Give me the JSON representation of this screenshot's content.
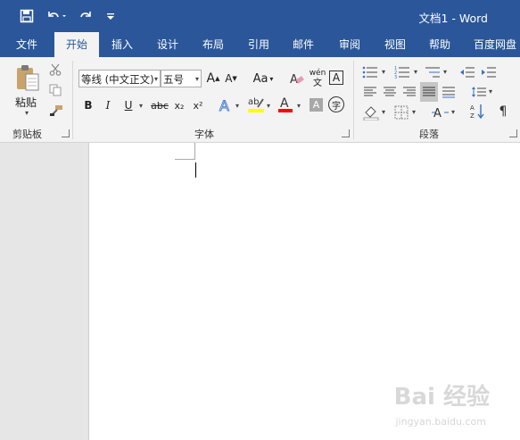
{
  "title_bar": {
    "document_title": "文档1 - Word",
    "quick_access": [
      {
        "name": "save-icon"
      },
      {
        "name": "undo-icon"
      },
      {
        "name": "redo-icon"
      },
      {
        "name": "customize-quick-access-icon"
      }
    ]
  },
  "tabs": [
    "文件",
    "开始",
    "插入",
    "设计",
    "布局",
    "引用",
    "邮件",
    "审阅",
    "视图",
    "帮助",
    "百度网盘"
  ],
  "active_tab": "开始",
  "clipboard": {
    "paste_label": "粘贴",
    "group_label": "剪贴板"
  },
  "font": {
    "font_name": "等线 (中文正文)",
    "font_size": "五号",
    "group_label": "字体",
    "bold": "B",
    "italic": "I",
    "underline": "U",
    "strikethrough": "abc",
    "subscript": "x₂",
    "superscript": "x²",
    "change_case": "Aa",
    "phonetic_top": "wén",
    "phonetic_bottom": "文",
    "char_border": "A",
    "shade": "A",
    "enclose": "字",
    "grow": "A",
    "shrink": "A",
    "highlight_color": "#ffff00",
    "font_color": "#ff0000"
  },
  "paragraph": {
    "group_label": "段落"
  },
  "watermark": {
    "text": "Bai 经验",
    "sub": "jingyan.baidu.com"
  }
}
